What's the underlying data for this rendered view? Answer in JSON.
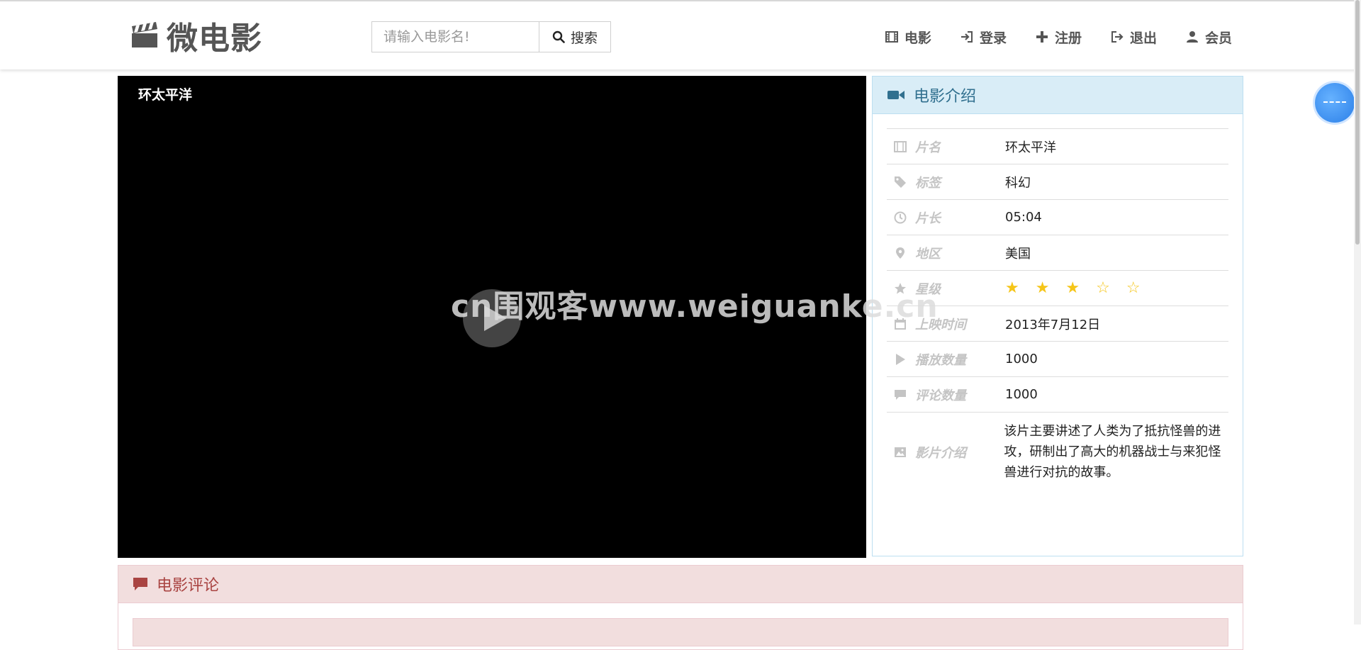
{
  "brand": {
    "name": "微电影",
    "icon": "clapperboard-icon"
  },
  "search": {
    "placeholder": "请输入电影名!",
    "value": "",
    "button_label": "搜索"
  },
  "nav": {
    "movies": "电影",
    "login": "登录",
    "register": "注册",
    "logout": "退出",
    "member": "会员"
  },
  "video": {
    "title": "环太平洋"
  },
  "info": {
    "heading": "电影介绍",
    "rows": {
      "name": {
        "label": "片名",
        "value": "环太平洋"
      },
      "tag": {
        "label": "标签",
        "value": "科幻"
      },
      "length": {
        "label": "片长",
        "value": "05:04"
      },
      "area": {
        "label": "地区",
        "value": "美国"
      },
      "star": {
        "label": "星级",
        "value": "★ ★ ★ ☆ ☆",
        "rating": 3,
        "max": 5
      },
      "release": {
        "label": "上映时间",
        "value": "2013年7月12日"
      },
      "plays": {
        "label": "播放数量",
        "value": "1000"
      },
      "comments": {
        "label": "评论数量",
        "value": "1000"
      },
      "intro": {
        "label": "影片介绍",
        "value": "该片主要讲述了人类为了抵抗怪兽的进攻，研制出了高大的机器战士与来犯怪兽进行对抗的故事。"
      }
    }
  },
  "comments": {
    "heading": "电影评论"
  },
  "watermark": "cn围观客www.weiguanke.cn",
  "colors": {
    "info_header_bg": "#d9edf7",
    "info_header_text": "#31708f",
    "comment_header_bg": "#f2dede",
    "comment_header_text": "#a94442",
    "star": "#f5c518"
  }
}
